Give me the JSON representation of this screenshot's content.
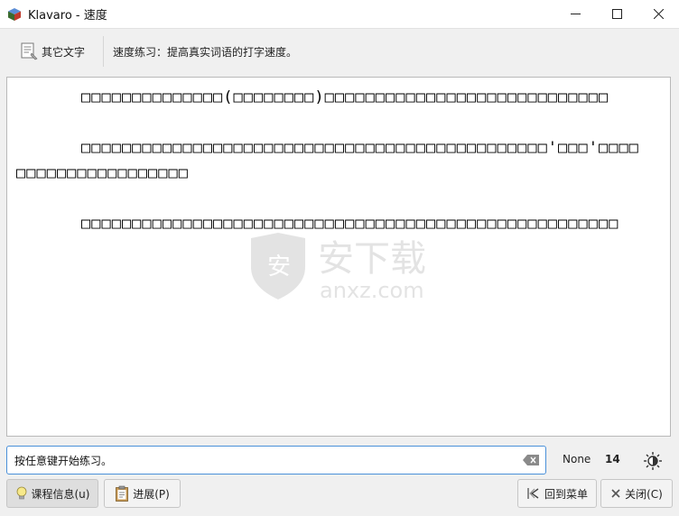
{
  "window": {
    "title": "Klavaro - 速度",
    "buttons": {
      "minimize": "minimize",
      "maximize": "maximize",
      "close": "close"
    }
  },
  "toolbar": {
    "other_text_label": "其它文字",
    "description": "速度练习：提高真实词语的打字速度。"
  },
  "text_area": {
    "paragraphs": [
      "□□□□□□□□□□□□□□(□□□□□□□□)□□□□□□□□□□□□□□□□□□□□□□□□□□□□",
      "□□□□□□□□□□□□□□□□□□□□□□□□□□□□□□□□□□□□□□□□□□□□□□'□□□'□□□□□□□□□□□□□□□□□□□□□",
      "□□□□□□□□□□□□□□□□□□□□□□□□□□□□□□□□□□□□□□□□□□□□□□□□□□□□□"
    ]
  },
  "input": {
    "value": "按任意键开始练习。"
  },
  "status": {
    "language": "None",
    "count": "14"
  },
  "buttons": {
    "course_info": "课程信息(u)",
    "progress": "进展(P)",
    "back_to_menu": "回到菜单",
    "close": "关闭(C)"
  },
  "colors": {
    "input_border": "#4a90d9",
    "accent_blue": "#1e6fd0"
  }
}
